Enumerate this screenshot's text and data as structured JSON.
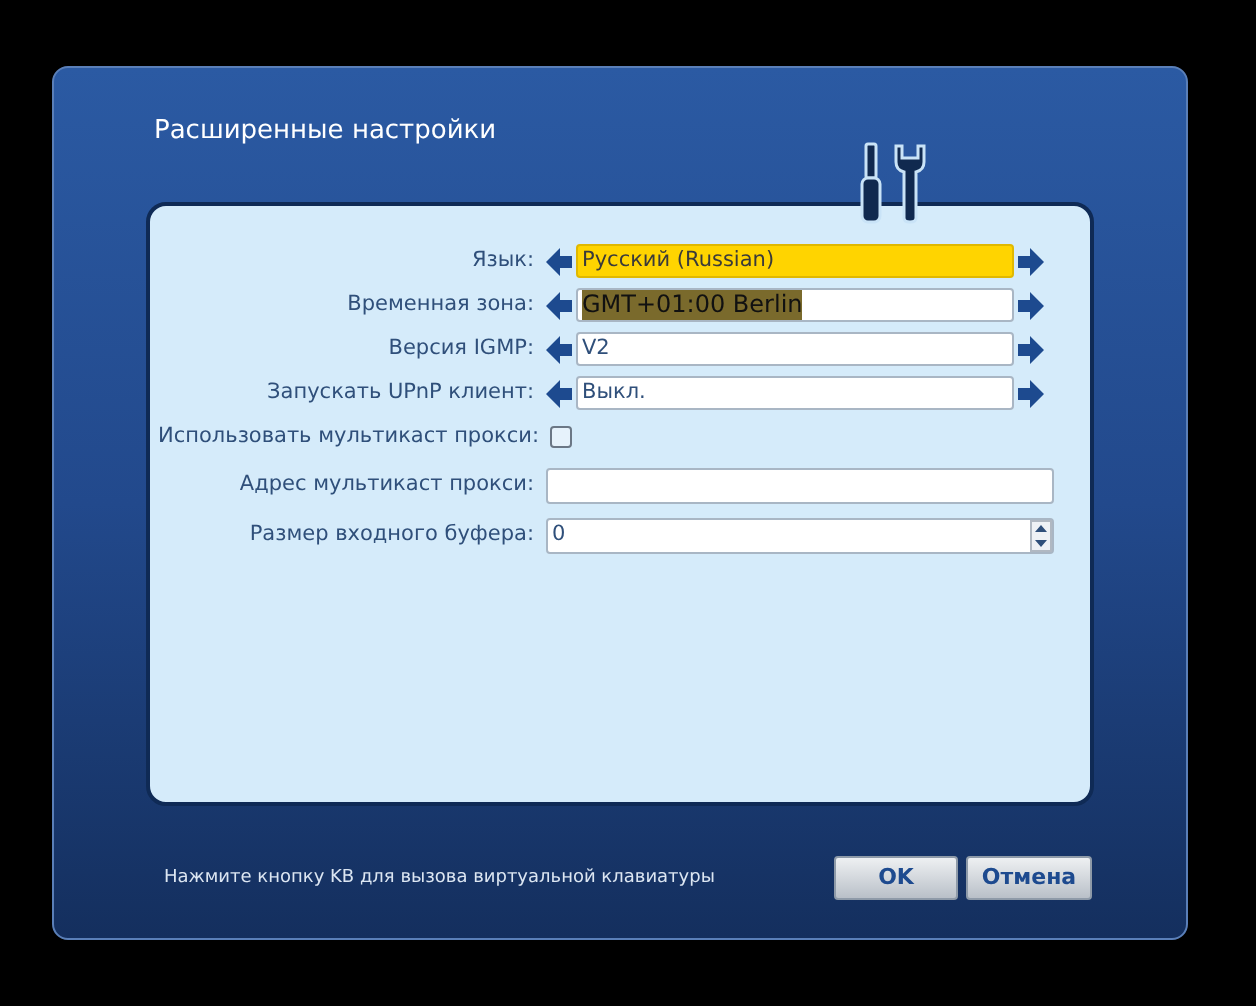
{
  "dialog": {
    "title": "Расширенные настройки"
  },
  "settings": [
    {
      "kind": "select",
      "label": "Язык:",
      "value": "Русский (Russian)",
      "focused": true,
      "text_selected": false
    },
    {
      "kind": "select",
      "label": "Временная зона:",
      "value": "GMT+01:00 Berlin",
      "focused": false,
      "text_selected": true
    },
    {
      "kind": "select",
      "label": "Версия IGMP:",
      "value": "V2",
      "focused": false,
      "text_selected": false
    },
    {
      "kind": "select",
      "label": "Запускать UPnP клиент:",
      "value": "Выкл.",
      "focused": false,
      "text_selected": false
    },
    {
      "kind": "checkbox",
      "label": "Использовать мультикаст прокси:",
      "checked": false
    },
    {
      "kind": "text",
      "label": "Адрес мультикаст прокси:"
    },
    {
      "kind": "spin",
      "label": "Размер входного буфера:",
      "value": "0"
    }
  ],
  "hint": "Нажмите кнопку KB для вызова виртуальной клавиатуры",
  "buttons": [
    "OK",
    "Отмена"
  ]
}
